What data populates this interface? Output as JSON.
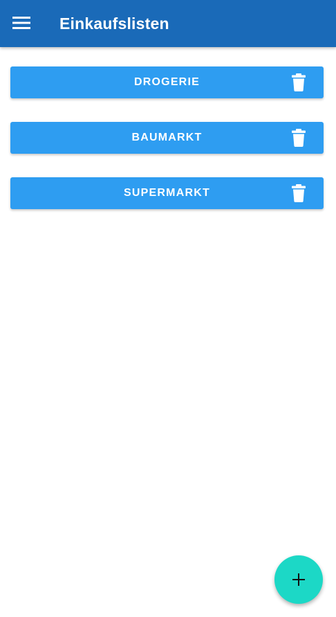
{
  "appbar": {
    "title": "Einkaufslisten",
    "menu_icon": "hamburger-menu-icon",
    "color": "#1a6ab8"
  },
  "lists": [
    {
      "label": "DROGERIE",
      "delete_icon": "trash-icon"
    },
    {
      "label": "BAUMARKT",
      "delete_icon": "trash-icon"
    },
    {
      "label": "SUPERMARKT",
      "delete_icon": "trash-icon"
    }
  ],
  "list_color": "#2e9df1",
  "fab": {
    "icon": "plus-icon",
    "color": "#1cd8c6"
  }
}
